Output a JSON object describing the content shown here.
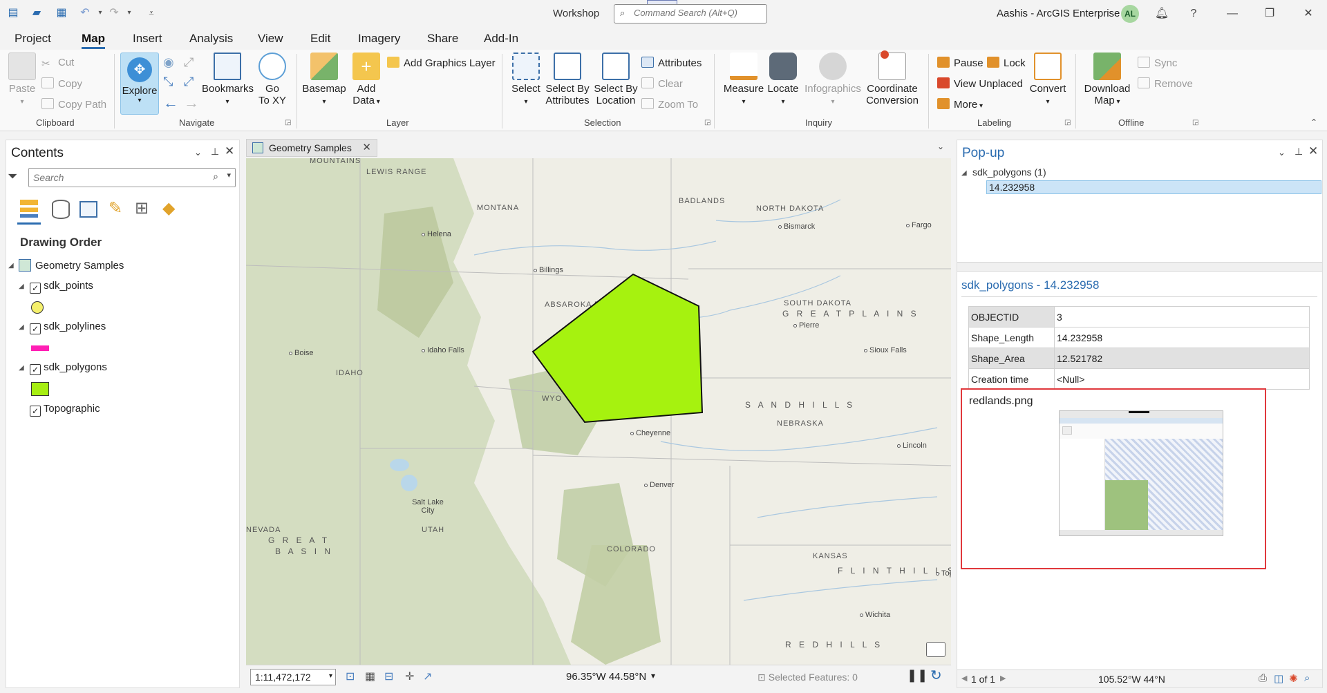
{
  "window": {
    "title": "Workshop",
    "search_placeholder": "Command Search (Alt+Q)",
    "user": "Aashis - ArcGIS Enterprise",
    "avatar_initials": "AL"
  },
  "tabs": [
    "Project",
    "Map",
    "Insert",
    "Analysis",
    "View",
    "Edit",
    "Imagery",
    "Share",
    "Add-In"
  ],
  "active_tab": "Map",
  "ribbon": {
    "clipboard": {
      "label": "Clipboard",
      "paste": "Paste",
      "cut": "Cut",
      "copy": "Copy",
      "copy_path": "Copy Path"
    },
    "navigate": {
      "label": "Navigate",
      "explore": "Explore",
      "bookmarks": "Bookmarks",
      "go_to_xy_1": "Go",
      "go_to_xy_2": "To XY"
    },
    "layer": {
      "label": "Layer",
      "basemap": "Basemap",
      "add_data_1": "Add",
      "add_data_2": "Data",
      "add_graphics_layer": "Add Graphics Layer"
    },
    "selection": {
      "label": "Selection",
      "select": "Select",
      "by_attr_1": "Select By",
      "by_attr_2": "Attributes",
      "by_loc_1": "Select By",
      "by_loc_2": "Location",
      "attributes": "Attributes",
      "clear": "Clear",
      "zoom_to": "Zoom To"
    },
    "inquiry": {
      "label": "Inquiry",
      "measure": "Measure",
      "locate": "Locate",
      "infographics": "Infographics",
      "coord_1": "Coordinate",
      "coord_2": "Conversion"
    },
    "labeling": {
      "label": "Labeling",
      "pause": "Pause",
      "lock": "Lock",
      "view_unplaced": "View Unplaced",
      "more": "More",
      "convert": "Convert"
    },
    "offline": {
      "label": "Offline",
      "download_1": "Download",
      "download_2": "Map",
      "sync": "Sync",
      "remove": "Remove"
    }
  },
  "contents": {
    "title": "Contents",
    "search_placeholder": "Search",
    "drawing_order": "Drawing Order",
    "map_name": "Geometry Samples",
    "layers": [
      {
        "name": "sdk_points",
        "checked": true
      },
      {
        "name": "sdk_polylines",
        "checked": true
      },
      {
        "name": "sdk_polygons",
        "checked": true
      },
      {
        "name": "Topographic",
        "checked": true
      }
    ],
    "colors": {
      "points": "#f5f06c",
      "polylines": "#ff1fb4",
      "polygons": "#a6ee11"
    }
  },
  "map": {
    "tab_title": "Geometry Samples",
    "scale": "1:11,472,172",
    "coordinates": "96.35°W 44.58°N",
    "selected_features": "Selected Features: 0",
    "polygon_color": "#a6f20f",
    "labels": {
      "montana": "MONTANA",
      "north_dakota": "NORTH DAKOTA",
      "south_dakota": "SOUTH DAKOTA",
      "badlands": "BADLANDS",
      "idaho": "IDAHO",
      "wyoming": "WYO",
      "nebraska": "NEBRASKA",
      "utah": "UTAH",
      "colorado": "COLORADO",
      "kansas": "KANSAS",
      "nevada": "NEVADA",
      "helena": "Helena",
      "billings": "Billings",
      "bismarck": "Bismarck",
      "fargo": "Fargo",
      "pierre": "Pierre",
      "sioux_falls": "Sioux Falls",
      "boise": "Boise",
      "idaho_falls": "Idaho Falls",
      "cheyenne": "Cheyenne",
      "denver": "Denver",
      "lincoln": "Lincoln",
      "salt_lake": "Salt Lake City",
      "wichita": "Wichita",
      "great_plains": "G R E A T   P L A I N S",
      "sand_hills": "S A N D   H I L L S",
      "great_basin_1": "G R E A T",
      "great_basin_2": "B A S I N",
      "red_hills": "R E D   H I L L S",
      "flint_hills": "F L I N T   H I L L S",
      "absaroka": "ABSAROKA RANGE",
      "lewis_range": "LEWIS RANGE",
      "mountains": "MOUNTAINS",
      "top": "Top"
    }
  },
  "popup": {
    "title": "Pop-up",
    "layer_node": "sdk_polygons (1)",
    "feature_node": "14.232958",
    "heading": "sdk_polygons - 14.232958",
    "fields": [
      {
        "key": "OBJECTID",
        "value": "3"
      },
      {
        "key": "Shape_Length",
        "value": "14.232958"
      },
      {
        "key": "Shape_Area",
        "value": "12.521782"
      },
      {
        "key": "Creation time",
        "value": "<Null>"
      }
    ],
    "media_title": "redlands.png",
    "pager": "1 of 1",
    "coords": "105.52°W 44°N"
  }
}
